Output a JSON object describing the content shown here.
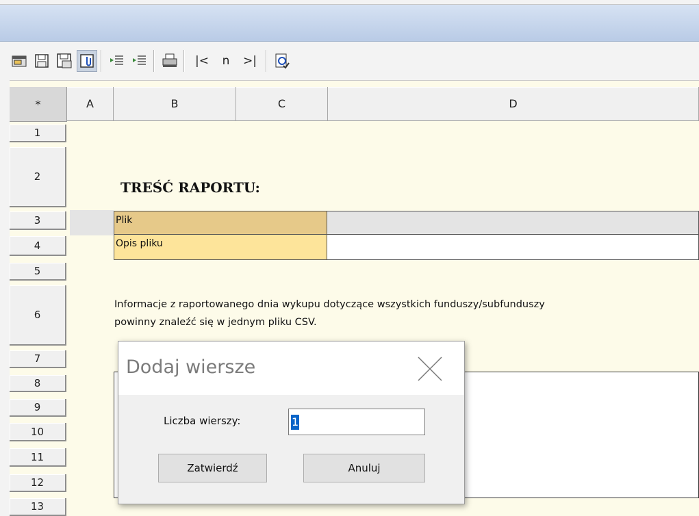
{
  "toolbar": {
    "nav_first": "|<",
    "nav_n": "n",
    "nav_last": ">|",
    "icons": [
      "open-icon",
      "save-icon",
      "save-as-icon",
      "attach-icon",
      "indent-left-icon",
      "indent-right-icon",
      "print-icon",
      "validate-icon"
    ]
  },
  "sheet": {
    "corner": "*",
    "columns": [
      "A",
      "B",
      "C",
      "D"
    ],
    "rows": [
      "1",
      "2",
      "3",
      "4",
      "5",
      "6",
      "7",
      "8",
      "9",
      "10",
      "11",
      "12",
      "13"
    ],
    "title": "TREŚĆ RAPORTU:",
    "fields": {
      "plik_label": "Plik",
      "opis_label": "Opis pliku"
    },
    "info_line1": "Informacje z raportowanego dnia wykupu dotyczące wszystkich funduszy/subfunduszy",
    "info_line2": "powinny znaleźć się w jednym pliku CSV."
  },
  "dialog": {
    "title": "Dodaj wiersze",
    "label": "Liczba wierszy:",
    "value": "1",
    "confirm": "Zatwierdź",
    "cancel": "Anuluj"
  },
  "colors": {
    "sheet_bg": "#fdfbe9",
    "label_dark": "#e6c989",
    "label_light": "#fde49a",
    "selection": "#0a64c8"
  }
}
